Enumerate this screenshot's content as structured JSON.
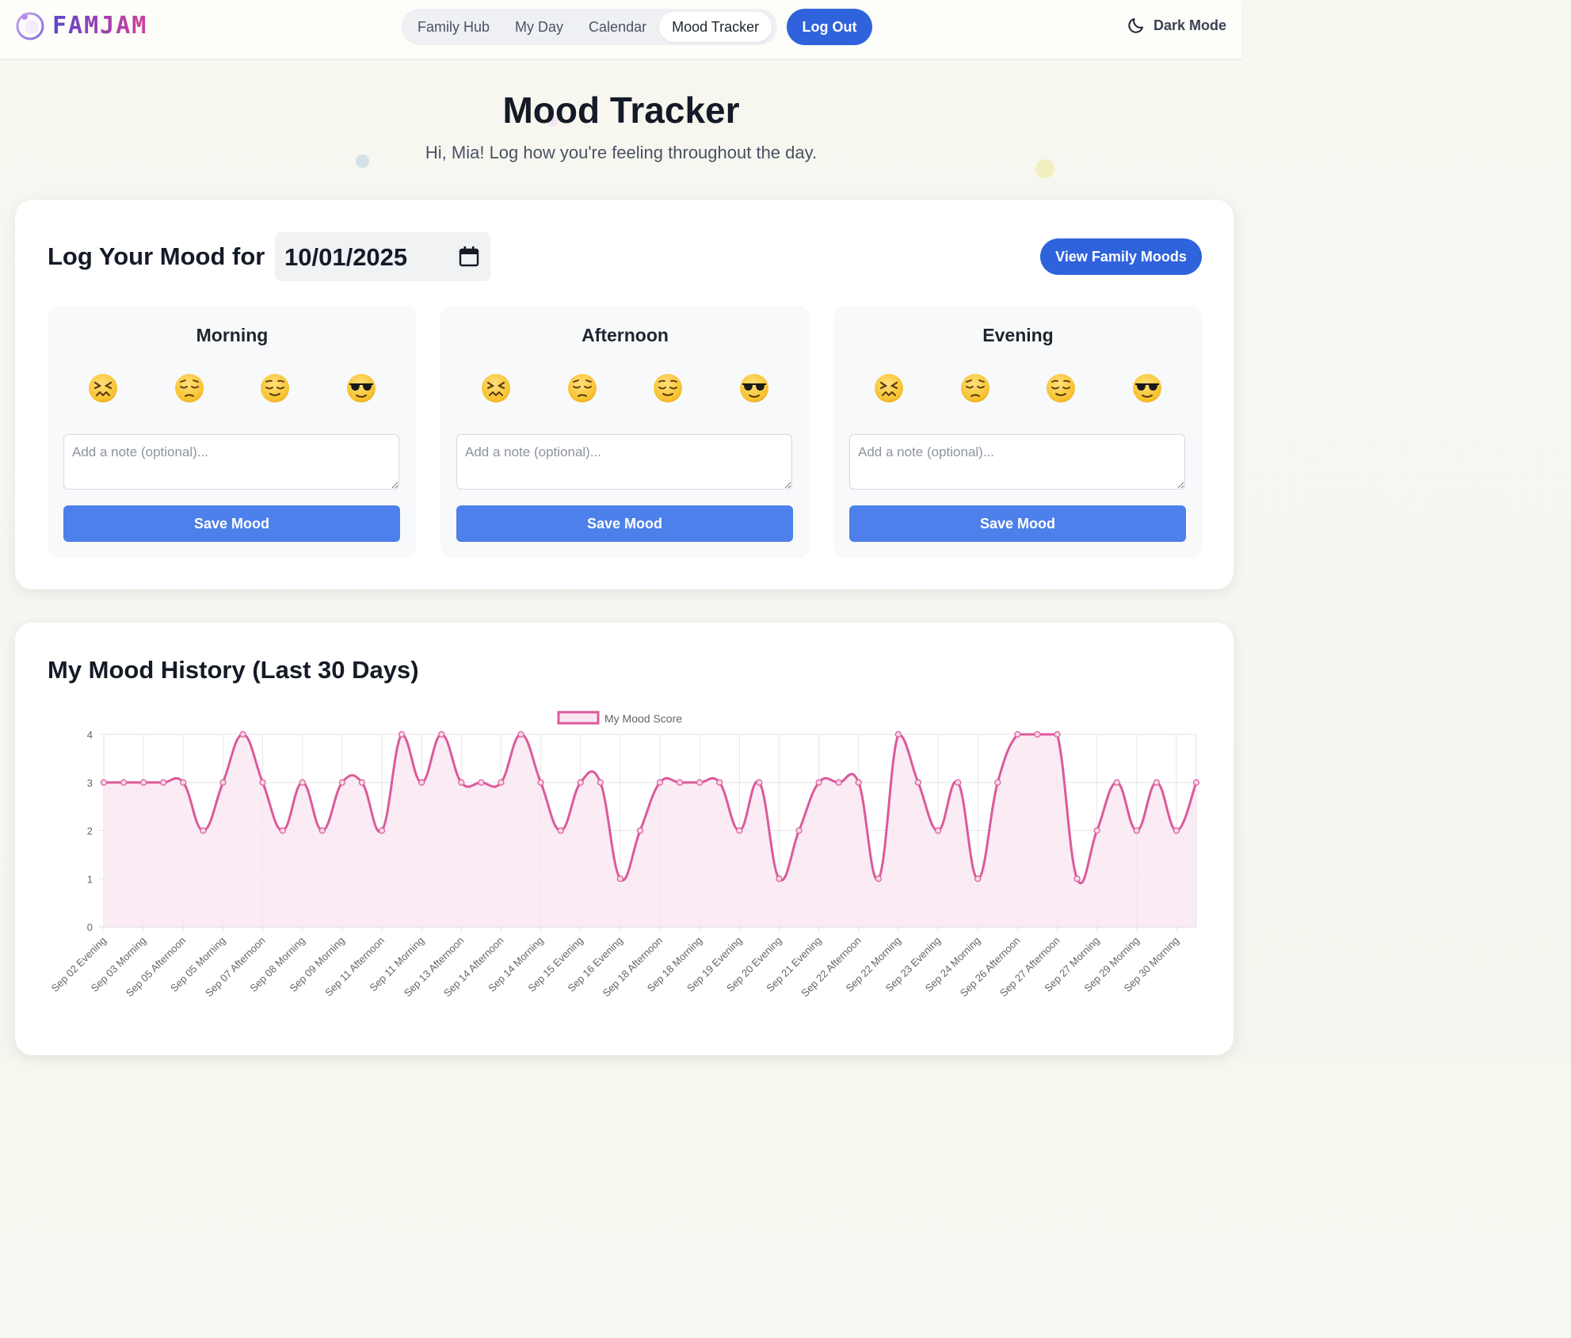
{
  "header": {
    "logo_text": "FAMJAM",
    "nav": [
      "Family Hub",
      "My Day",
      "Calendar",
      "Mood Tracker"
    ],
    "active_nav": "Mood Tracker",
    "logout_label": "Log Out",
    "dark_mode_label": "Dark Mode"
  },
  "page": {
    "title": "Mood Tracker",
    "subtitle": "Hi, Mia! Log how you're feeling throughout the day."
  },
  "log": {
    "title": "Log Your Mood for",
    "date": "10/01/2025",
    "family_button": "View Family Moods",
    "periods": [
      {
        "title": "Morning",
        "note_placeholder": "Add a note (optional)...",
        "save_label": "Save Mood"
      },
      {
        "title": "Afternoon",
        "note_placeholder": "Add a note (optional)...",
        "save_label": "Save Mood"
      },
      {
        "title": "Evening",
        "note_placeholder": "Add a note (optional)...",
        "save_label": "Save Mood"
      }
    ],
    "emoji_icons": [
      "confounded-face-icon",
      "pensive-face-icon",
      "relieved-face-icon",
      "sunglasses-face-icon"
    ]
  },
  "history": {
    "title": "My Mood History (Last 30 Days)"
  },
  "colors": {
    "accent": "#2f63dc",
    "save_button": "#4d80ea",
    "line": "#dc5a9b",
    "fill": "#f9e6f1"
  },
  "chart_data": {
    "type": "line",
    "series": [
      {
        "name": "My Mood Score",
        "values": [
          3,
          3,
          3,
          3,
          3,
          2,
          3,
          4,
          3,
          2,
          3,
          2,
          3,
          3,
          2,
          4,
          3,
          4,
          3,
          3,
          3,
          4,
          3,
          2,
          3,
          3,
          1,
          2,
          3,
          3,
          3,
          3,
          2,
          3,
          1,
          2,
          3,
          3,
          3,
          1,
          4,
          3,
          2,
          3,
          1,
          3,
          4,
          4,
          4,
          1,
          2,
          3,
          2,
          3,
          2,
          3
        ]
      }
    ],
    "x": [
      "Sep 02 Evening",
      "",
      "Sep 03 Morning",
      "",
      "Sep 05 Afternoon",
      "",
      "Sep 05 Morning",
      "",
      "Sep 07 Afternoon",
      "",
      "Sep 08 Morning",
      "",
      "Sep 09 Morning",
      "",
      "Sep 11 Afternoon",
      "",
      "Sep 11 Morning",
      "",
      "Sep 13 Afternoon",
      "",
      "Sep 14 Afternoon",
      "",
      "Sep 14 Morning",
      "",
      "Sep 15 Evening",
      "",
      "Sep 16 Evening",
      "",
      "Sep 18 Afternoon",
      "",
      "Sep 18 Morning",
      "",
      "Sep 19 Evening",
      "",
      "Sep 20 Evening",
      "",
      "Sep 21 Evening",
      "",
      "Sep 22 Afternoon",
      "",
      "Sep 22 Morning",
      "",
      "Sep 23 Evening",
      "",
      "Sep 24 Morning",
      "",
      "Sep 26 Afternoon",
      "",
      "Sep 27 Afternoon",
      "",
      "Sep 27 Morning",
      "",
      "Sep 29 Morning",
      "",
      "Sep 30 Morning",
      ""
    ],
    "yticks": [
      0,
      1,
      2,
      3,
      4
    ],
    "ylim": [
      0,
      4
    ],
    "grid": true,
    "legend_position": "top-center"
  }
}
